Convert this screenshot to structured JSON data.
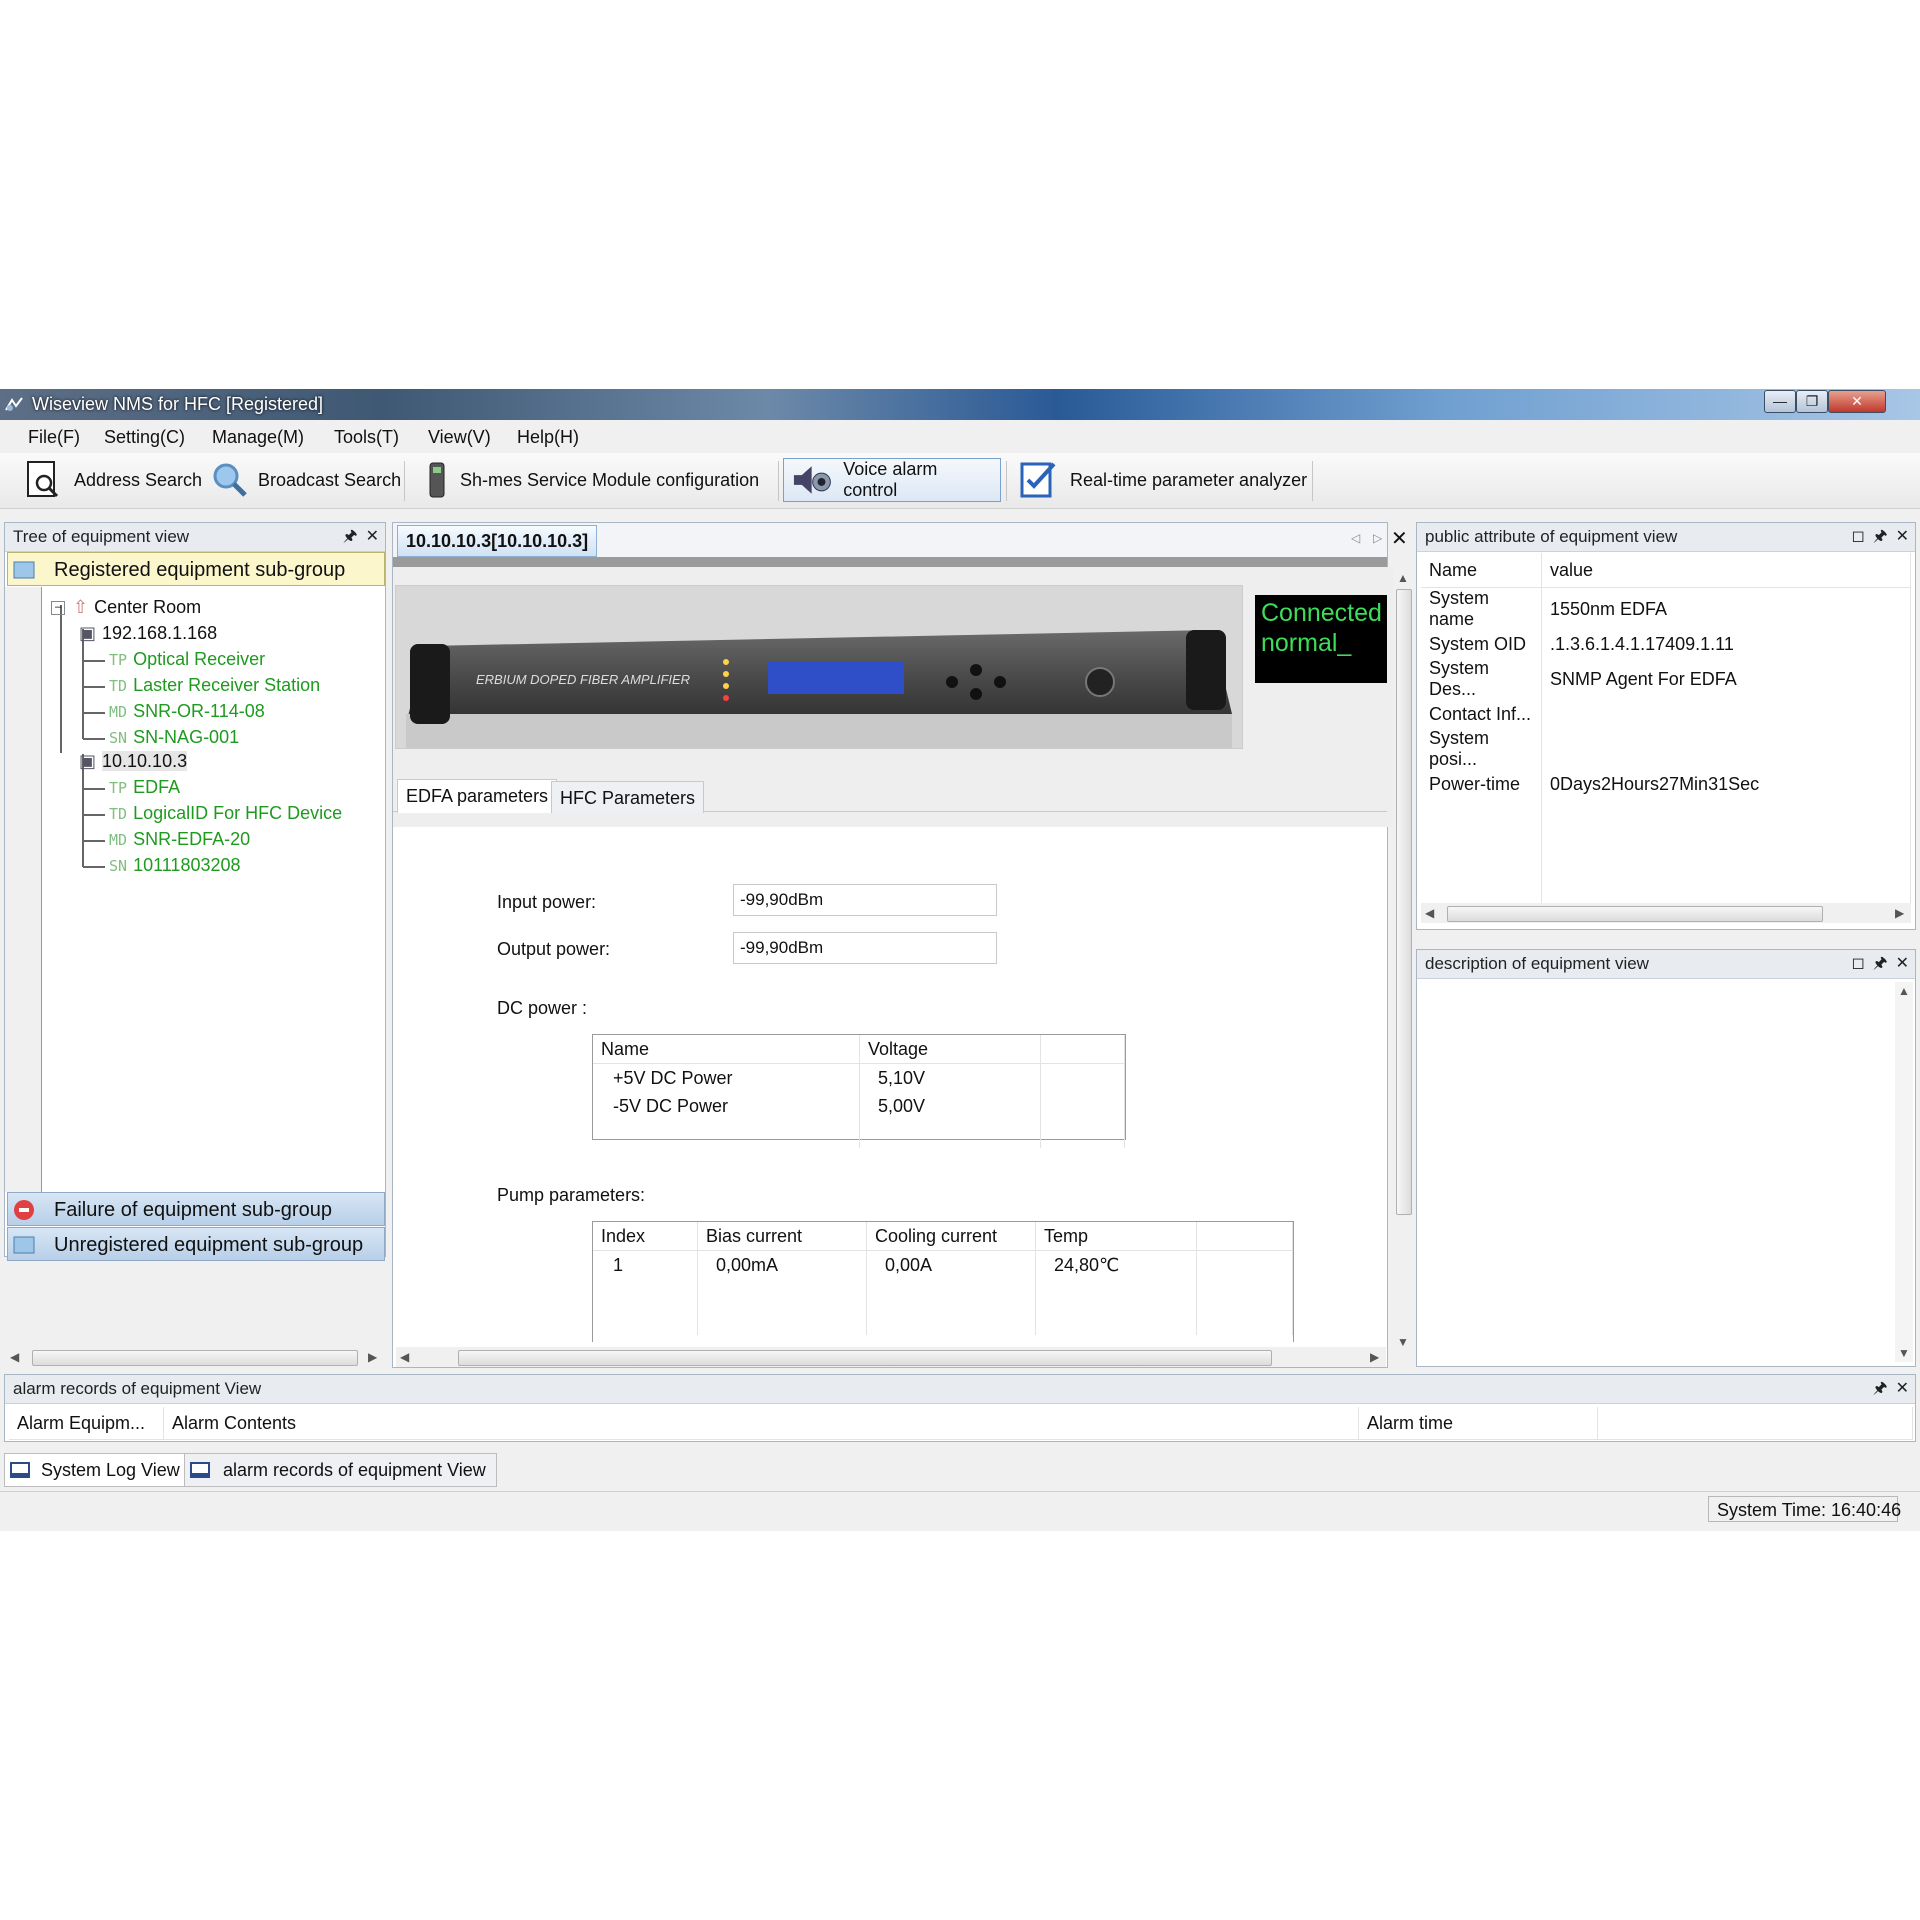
{
  "window": {
    "title": "Wiseview NMS for HFC  [Registered]"
  },
  "menu": [
    "File(F)",
    "Setting(C)",
    "Manage(M)",
    "Tools(T)",
    "View(V)",
    "Help(H)"
  ],
  "toolbar": {
    "address_search": "Address Search",
    "broadcast_search": "Broadcast Search",
    "shmes": "Sh-mes Service Module configuration",
    "voice_alarm": "Voice alarm control",
    "realtime": "Real-time parameter analyzer"
  },
  "tree_panel": {
    "title": "Tree of equipment view",
    "registered_group": "Registered equipment sub-group",
    "failure_group": "Failure of equipment sub-group",
    "unregistered_group": "Unregistered equipment sub-group",
    "root": "Center Room",
    "hosts": [
      {
        "ip": "192.168.1.168",
        "children": [
          {
            "prefix": "TP",
            "label": "Optical Receiver"
          },
          {
            "prefix": "TD",
            "label": "Laster Receiver Station"
          },
          {
            "prefix": "MD",
            "label": "SNR-OR-114-08"
          },
          {
            "prefix": "SN",
            "label": "SN-NAG-001"
          }
        ]
      },
      {
        "ip": "10.10.10.3",
        "children": [
          {
            "prefix": "TP",
            "label": "EDFA"
          },
          {
            "prefix": "TD",
            "label": "LogicalID For HFC Device"
          },
          {
            "prefix": "MD",
            "label": "SNR-EDFA-20"
          },
          {
            "prefix": "SN",
            "label": "10111803208"
          }
        ]
      }
    ]
  },
  "device_tab": {
    "title": "10.10.10.3[10.10.10.3]"
  },
  "device_image": {
    "brand_text": "ERBIUM DOPED FIBER AMPLIFIER"
  },
  "status": {
    "line1": "Connected",
    "line2": "normal_",
    "color": "#3ddc5a"
  },
  "param_tabs": [
    "EDFA parameters",
    "HFC Parameters"
  ],
  "edfa": {
    "input_power_label": "Input power:",
    "input_power": "-99,90dBm",
    "output_power_label": "Output power:",
    "output_power": "-99,90dBm",
    "dc_label": "DC power :",
    "dc_headers": [
      "Name",
      "Voltage"
    ],
    "dc_rows": [
      [
        "+5V DC Power",
        "5,10V"
      ],
      [
        "-5V DC Power",
        "5,00V"
      ]
    ],
    "pump_label": "Pump parameters:",
    "pump_headers": [
      "Index",
      "Bias current",
      "Cooling current",
      "Temp"
    ],
    "pump_rows": [
      [
        "1",
        "0,00mA",
        "0,00A",
        "24,80℃"
      ]
    ]
  },
  "attr_panel": {
    "title": "public attribute of equipment view",
    "headers": [
      "Name",
      "value"
    ],
    "rows": [
      [
        "System name",
        "1550nm EDFA"
      ],
      [
        "System OID",
        ".1.3.6.1.4.1.17409.1.11"
      ],
      [
        "System Des...",
        "SNMP Agent For EDFA"
      ],
      [
        "Contact Inf...",
        ""
      ],
      [
        "System posi...",
        ""
      ],
      [
        "Power-time",
        "0Days2Hours27Min31Sec"
      ]
    ]
  },
  "desc_panel": {
    "title": "description of equipment view"
  },
  "alarm_panel": {
    "title": "alarm records of equipment View",
    "headers": [
      "Alarm Equipm...",
      "Alarm Contents",
      "Alarm time"
    ]
  },
  "bottom_tabs": [
    "System Log View",
    "alarm records of equipment View"
  ],
  "statusbar": {
    "time": "System Time: 16:40:46"
  }
}
